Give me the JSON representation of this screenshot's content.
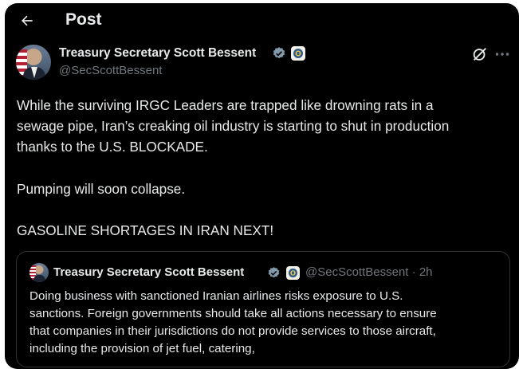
{
  "header": {
    "title": "Post",
    "back_icon": "arrow-left-icon"
  },
  "author": {
    "name": "Treasury Secretary Scott Bessent",
    "handle": "@SecScottBessent",
    "verified_color": "#829aab",
    "badge_icon": "treasury-seal-icon"
  },
  "actions": {
    "grok_icon": "grok-icon",
    "more_icon": "more-options-icon"
  },
  "post": {
    "lines": [
      "While the surviving IRGC Leaders are trapped like drowning rats in a",
      "sewage pipe, Iran’s creaking oil industry is starting to shut in production",
      "thanks to the U.S. BLOCKADE.",
      "Pumping will soon collapse.",
      "GASOLINE SHORTAGES IN IRAN NEXT!"
    ]
  },
  "quote": {
    "name": "Treasury Secretary Scott Bessent",
    "handle": "@SecScottBessent",
    "separator": "·",
    "time": "2h",
    "lines": [
      "Doing business with sanctioned Iranian airlines risks exposure to U.S.",
      "sanctions.  Foreign governments should take all actions necessary to ensure",
      "that companies in their jurisdictions do not provide services to those aircraft,",
      "including the provision of jet fuel, catering,"
    ]
  },
  "colors": {
    "background": "#000000",
    "text": "#e7e9ea",
    "secondary": "#71767b",
    "border": "#2f3336"
  }
}
